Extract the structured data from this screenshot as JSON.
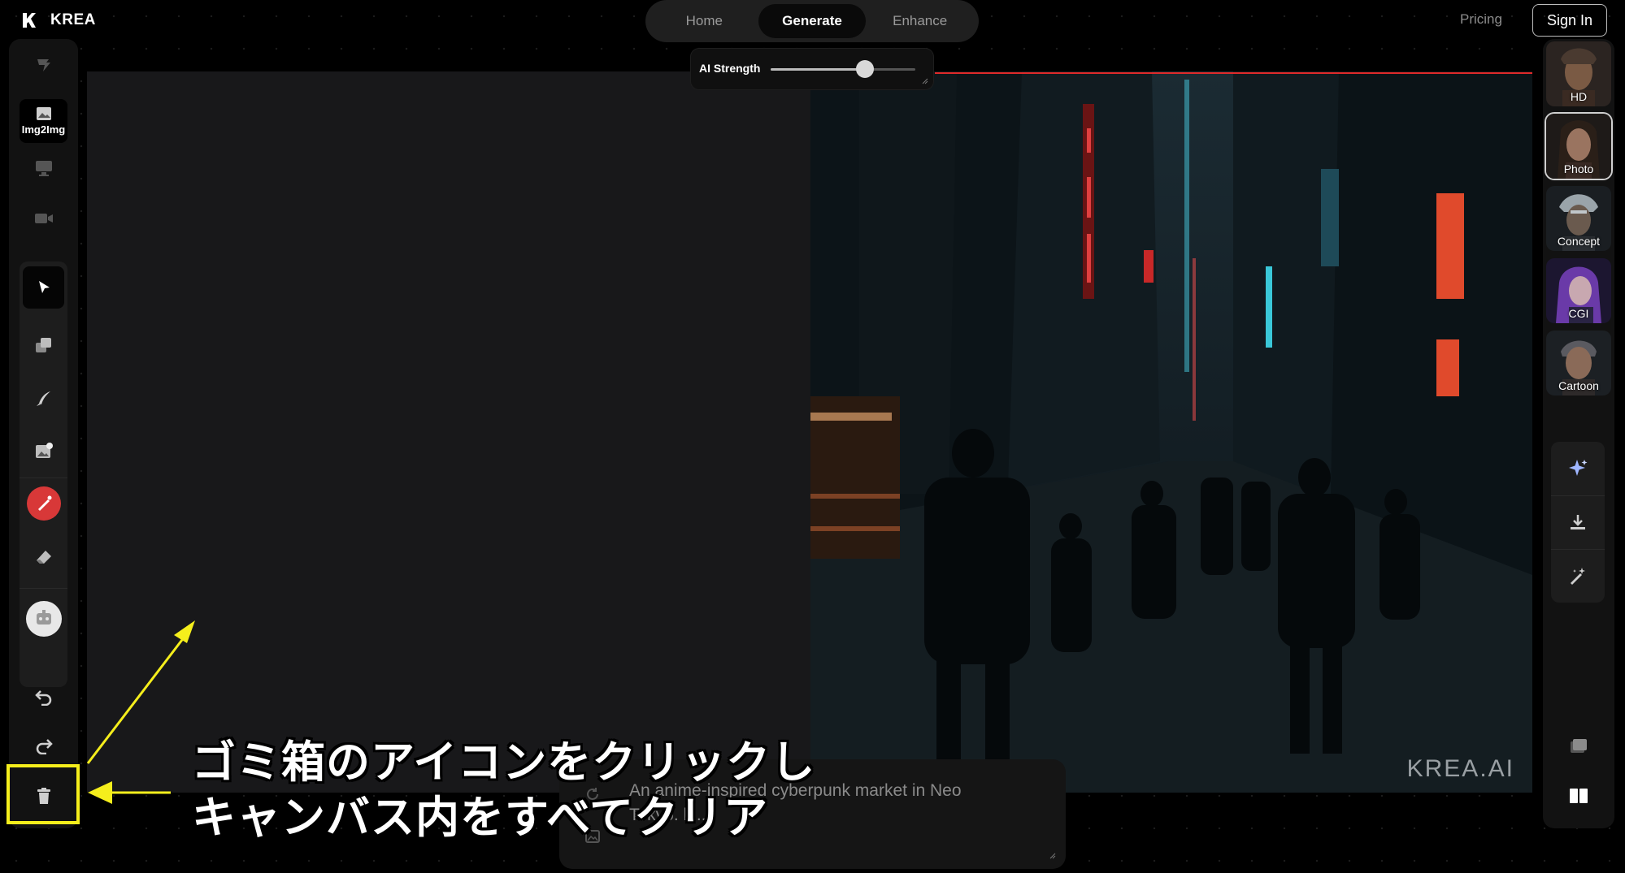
{
  "app": {
    "name": "KREA"
  },
  "nav": {
    "tabs": [
      "Home",
      "Generate",
      "Enhance"
    ],
    "active": "Generate"
  },
  "header": {
    "pricing": "Pricing",
    "sign_in": "Sign In"
  },
  "left_sidebar": {
    "modes": [
      {
        "name": "realtime-icon",
        "label": ""
      },
      {
        "name": "image-icon",
        "label": "Img2Img"
      },
      {
        "name": "screen-icon",
        "label": ""
      },
      {
        "name": "video-icon",
        "label": ""
      }
    ],
    "tools": [
      "pointer-icon",
      "layers-icon",
      "brush-icon",
      "add-image-icon",
      "red-color-icon",
      "eraser-icon",
      "ai-mask-icon"
    ],
    "history": [
      "undo-icon",
      "redo-icon",
      "trash-icon"
    ]
  },
  "ai_strength": {
    "label": "AI Strength",
    "value": 0.65
  },
  "canvas": {
    "watermark": "KREA.AI"
  },
  "styles": [
    {
      "label": "HD",
      "selected": false
    },
    {
      "label": "Photo",
      "selected": true
    },
    {
      "label": "Concept",
      "selected": false
    },
    {
      "label": "CGI",
      "selected": false
    },
    {
      "label": "Cartoon",
      "selected": false
    }
  ],
  "right_actions": [
    "sparkle-icon",
    "download-icon",
    "magic-wand-icon"
  ],
  "right_bottom": [
    "layers-view-icon",
    "split-view-icon"
  ],
  "prompt": {
    "text": "An anime-inspired cyberpunk market in Neo Tokyo. hi..."
  },
  "annotation": {
    "line1": "ゴミ箱のアイコンをクリックし",
    "line2": "キャンバス内をすべてクリア",
    "color": "#f5ee1c"
  }
}
